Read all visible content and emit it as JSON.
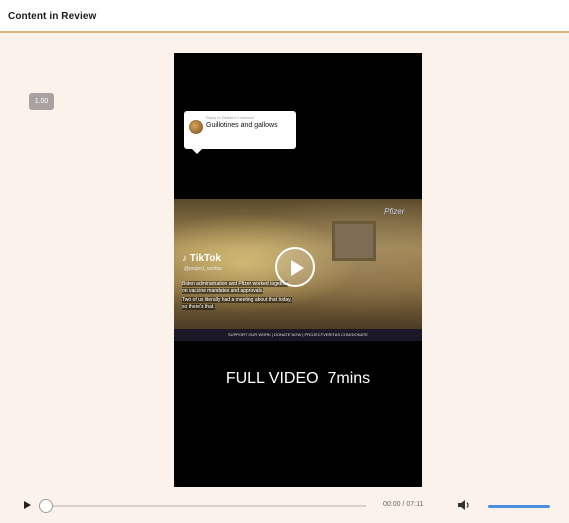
{
  "header": {
    "title": "Content in Review"
  },
  "player": {
    "speed_badge": "1.00",
    "video": {
      "reply_bubble": {
        "reply_to": "Reply to Deleted Comment",
        "text": "Guillotines and gallows"
      },
      "scene": {
        "brand_logo": "Pfizer",
        "tiktok_logo": "♪ TikTok",
        "tiktok_handle": "@project_veritas",
        "captions": [
          "Biden administration and Pfizer worked together",
          "on vaccine mandates and approvals.",
          "Two of us literally had a meeting about that today,",
          "so there's that."
        ],
        "bottom_strip": "SUPPORT OUR WORK  |  DONATE NOW  |  PROJECTVERITAS.COM/DONATE"
      },
      "overlay_text": "FULL VIDEO  7mins"
    },
    "controls": {
      "time": "00:00 / 07:11",
      "progress_fraction": 0.0,
      "volume_fraction": 1.0
    }
  },
  "icons": {
    "play": "play-icon",
    "volume": "volume-icon",
    "video_play": "play-circle-icon"
  },
  "colors": {
    "background": "#fcf2ec",
    "header_border": "#d9b77c",
    "volume_accent": "#4a90e2"
  }
}
